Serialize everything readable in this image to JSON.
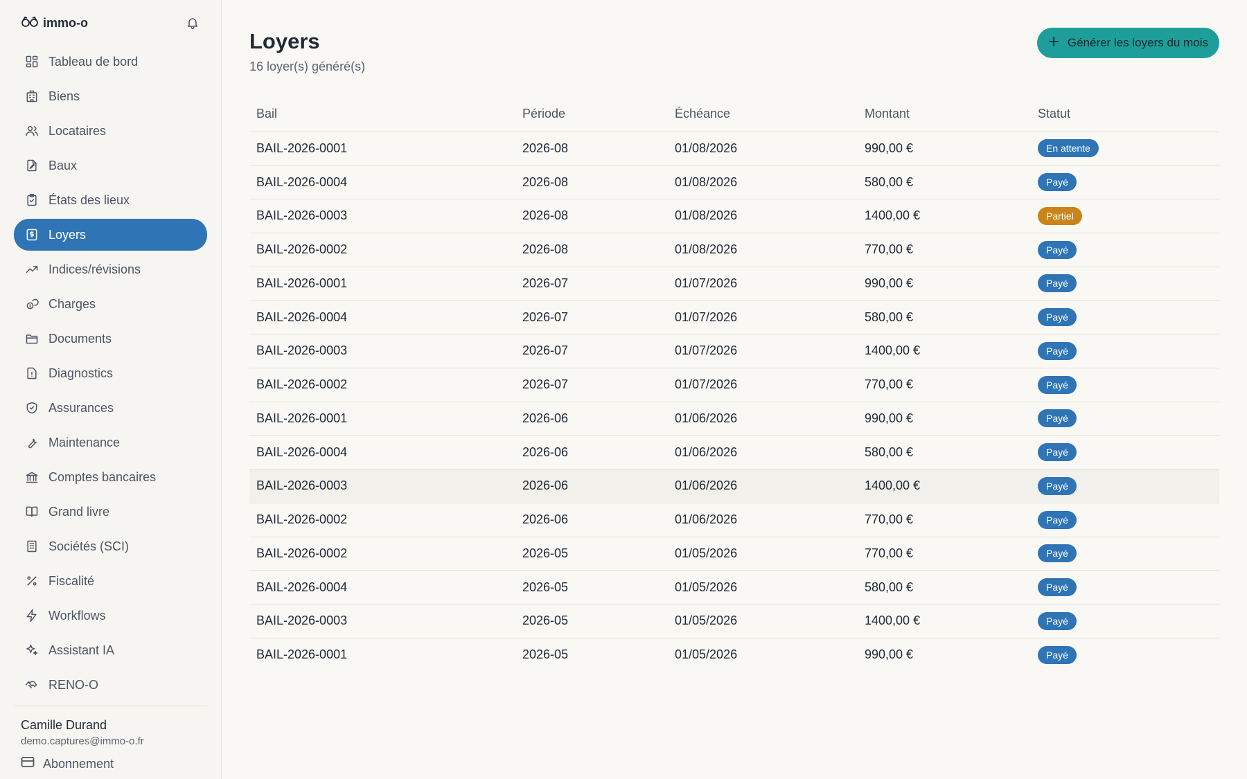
{
  "brand": {
    "name": "immo-o"
  },
  "nav": [
    {
      "label": "Tableau de bord",
      "icon": "dashboard-icon",
      "active": false
    },
    {
      "label": "Biens",
      "icon": "building-icon",
      "active": false
    },
    {
      "label": "Locataires",
      "icon": "users-icon",
      "active": false
    },
    {
      "label": "Baux",
      "icon": "contract-icon",
      "active": false
    },
    {
      "label": "États des lieux",
      "icon": "clipboard-icon",
      "active": false
    },
    {
      "label": "Loyers",
      "icon": "rent-icon",
      "active": true
    },
    {
      "label": "Indices/révisions",
      "icon": "trending-icon",
      "active": false
    },
    {
      "label": "Charges",
      "icon": "coins-icon",
      "active": false
    },
    {
      "label": "Documents",
      "icon": "folder-icon",
      "active": false
    },
    {
      "label": "Diagnostics",
      "icon": "alert-file-icon",
      "active": false
    },
    {
      "label": "Assurances",
      "icon": "shield-icon",
      "active": false
    },
    {
      "label": "Maintenance",
      "icon": "wrench-icon",
      "active": false
    },
    {
      "label": "Comptes bancaires",
      "icon": "bank-icon",
      "active": false
    },
    {
      "label": "Grand livre",
      "icon": "book-icon",
      "active": false
    },
    {
      "label": "Sociétés (SCI)",
      "icon": "office-icon",
      "active": false
    },
    {
      "label": "Fiscalité",
      "icon": "percent-icon",
      "active": false
    },
    {
      "label": "Workflows",
      "icon": "bolt-icon",
      "active": false
    },
    {
      "label": "Assistant IA",
      "icon": "sparkles-icon",
      "active": false
    },
    {
      "label": "RENO-O",
      "icon": "handshake-icon",
      "active": false
    }
  ],
  "user": {
    "name": "Camille Durand",
    "email": "demo.captures@immo-o.fr",
    "subscription_label": "Abonnement"
  },
  "page": {
    "title": "Loyers",
    "subtitle": "16 loyer(s) généré(s)",
    "generate_button": "Générer les loyers du mois"
  },
  "table": {
    "headers": [
      "Bail",
      "Période",
      "Échéance",
      "Montant",
      "Statut"
    ],
    "rows": [
      {
        "bail": "BAIL-2026-0001",
        "periode": "2026-08",
        "echeance": "01/08/2026",
        "montant": "990,00 €",
        "statut": "En attente",
        "status_color": "#2f74b5"
      },
      {
        "bail": "BAIL-2026-0004",
        "periode": "2026-08",
        "echeance": "01/08/2026",
        "montant": "580,00 €",
        "statut": "Payé",
        "status_color": "#2f74b5"
      },
      {
        "bail": "BAIL-2026-0003",
        "periode": "2026-08",
        "echeance": "01/08/2026",
        "montant": "1400,00 €",
        "statut": "Partiel",
        "status_color": "#c98519"
      },
      {
        "bail": "BAIL-2026-0002",
        "periode": "2026-08",
        "echeance": "01/08/2026",
        "montant": "770,00 €",
        "statut": "Payé",
        "status_color": "#2f74b5"
      },
      {
        "bail": "BAIL-2026-0001",
        "periode": "2026-07",
        "echeance": "01/07/2026",
        "montant": "990,00 €",
        "statut": "Payé",
        "status_color": "#2f74b5"
      },
      {
        "bail": "BAIL-2026-0004",
        "periode": "2026-07",
        "echeance": "01/07/2026",
        "montant": "580,00 €",
        "statut": "Payé",
        "status_color": "#2f74b5"
      },
      {
        "bail": "BAIL-2026-0003",
        "periode": "2026-07",
        "echeance": "01/07/2026",
        "montant": "1400,00 €",
        "statut": "Payé",
        "status_color": "#2f74b5"
      },
      {
        "bail": "BAIL-2026-0002",
        "periode": "2026-07",
        "echeance": "01/07/2026",
        "montant": "770,00 €",
        "statut": "Payé",
        "status_color": "#2f74b5"
      },
      {
        "bail": "BAIL-2026-0001",
        "periode": "2026-06",
        "echeance": "01/06/2026",
        "montant": "990,00 €",
        "statut": "Payé",
        "status_color": "#2f74b5"
      },
      {
        "bail": "BAIL-2026-0004",
        "periode": "2026-06",
        "echeance": "01/06/2026",
        "montant": "580,00 €",
        "statut": "Payé",
        "status_color": "#2f74b5"
      },
      {
        "bail": "BAIL-2026-0003",
        "periode": "2026-06",
        "echeance": "01/06/2026",
        "montant": "1400,00 €",
        "statut": "Payé",
        "status_color": "#2f74b5"
      },
      {
        "bail": "BAIL-2026-0002",
        "periode": "2026-06",
        "echeance": "01/06/2026",
        "montant": "770,00 €",
        "statut": "Payé",
        "status_color": "#2f74b5"
      },
      {
        "bail": "BAIL-2026-0002",
        "periode": "2026-05",
        "echeance": "01/05/2026",
        "montant": "770,00 €",
        "statut": "Payé",
        "status_color": "#2f74b5"
      },
      {
        "bail": "BAIL-2026-0004",
        "periode": "2026-05",
        "echeance": "01/05/2026",
        "montant": "580,00 €",
        "statut": "Payé",
        "status_color": "#2f74b5"
      },
      {
        "bail": "BAIL-2026-0003",
        "periode": "2026-05",
        "echeance": "01/05/2026",
        "montant": "1400,00 €",
        "statut": "Payé",
        "status_color": "#2f74b5"
      },
      {
        "bail": "BAIL-2026-0001",
        "periode": "2026-05",
        "echeance": "01/05/2026",
        "montant": "990,00 €",
        "statut": "Payé",
        "status_color": "#2f74b5"
      }
    ]
  }
}
